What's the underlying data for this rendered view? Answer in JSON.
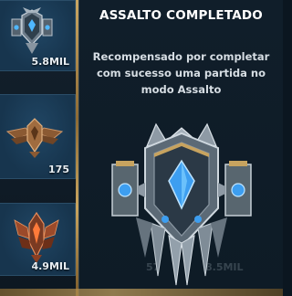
{
  "sidebar": {
    "cards": [
      {
        "value": "5.8MIL",
        "icon": "shield-crest-icon"
      },
      {
        "value": "175",
        "icon": "winged-bronze-crest-icon"
      },
      {
        "value": "4.9MIL",
        "icon": "flame-wing-crest-icon"
      }
    ]
  },
  "tooltip": {
    "title": "ASSALTO COMPLETADO",
    "description": "Recompensado por completar com sucesso uma partida no modo Assalto",
    "emblem": "assault-shield-emblem-icon",
    "ghost_values": [
      "57",
      "8.5MIL"
    ]
  },
  "colors": {
    "card_bg": "#17354e",
    "rail_gold": "#caa763",
    "gem_blue": "#4fb7ff",
    "tooltip_bg": "#101e2a"
  }
}
